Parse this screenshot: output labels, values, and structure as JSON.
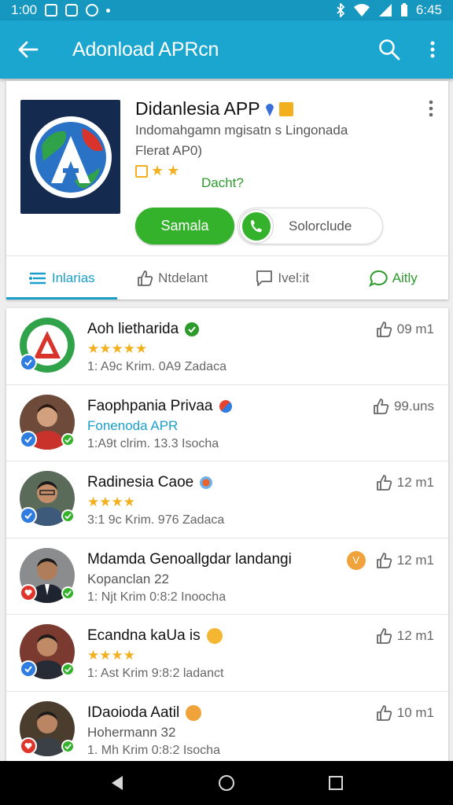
{
  "status_bar": {
    "time": "1:00",
    "right_time": "6:45"
  },
  "app_bar": {
    "title": "Adonload APRcn"
  },
  "app": {
    "name": "Didanlesia APP",
    "description_line1": "Indomahgamn mgisatn s Lingonada",
    "description_line2": "Flerat AP0)",
    "status": "Dacht?",
    "primary_button": "Samala",
    "secondary_button": "Solorclude"
  },
  "tabs": [
    {
      "label": "Inlarias",
      "icon": "list-icon"
    },
    {
      "label": "Ntdelant",
      "icon": "thumbs-up-icon"
    },
    {
      "label": "Ivel:it",
      "icon": "comment-icon"
    },
    {
      "label": "Aitly",
      "icon": "chat-bubble-icon"
    }
  ],
  "reviews": [
    {
      "title": "Aoh lietharida",
      "sub": "★★★★★",
      "meta": "1: A9c Krim. 0A9 Zadaca",
      "right": "09 m1"
    },
    {
      "title": "Faophpania Privaa",
      "sub": "Fonenoda APR",
      "meta": "1:A9t clrim. 13.3 Isocha",
      "right": "99.uns"
    },
    {
      "title": "Radinesia Caoe",
      "sub": "★★★★",
      "meta": "3:1 9c Krim. 976 Zadaca",
      "right": "12 m1"
    },
    {
      "title": "Mdamda Genoallgdar landangi",
      "sub": "Kopanclan 22",
      "meta": "1: Njt Krim 0:8:2 Inoocha",
      "right": "12 m1",
      "badge": "V"
    },
    {
      "title": "Ecandna kaUa is",
      "sub": "★★★★",
      "meta": "1: Ast Krim 9:8:2 ladanct",
      "right": "12 m1"
    },
    {
      "title": "IDaoioda Aatil",
      "sub": "Hohermann 32",
      "meta": "1. Mh Krim 0:8:2 Isocha",
      "right": "10 m1"
    }
  ],
  "colors": {
    "primary": "#1ba6cf",
    "accent_green": "#34b22c",
    "star": "#f2b01e"
  }
}
